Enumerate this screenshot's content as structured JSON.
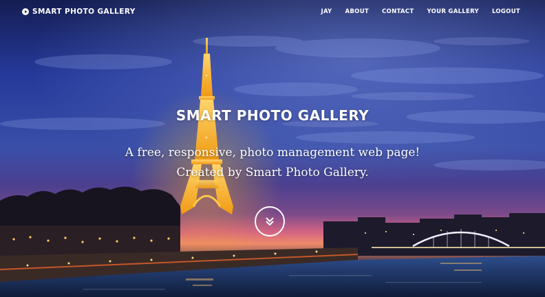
{
  "navbar": {
    "brand_icon": "play-circle-icon",
    "brand_label": "SMART PHOTO GALLERY",
    "links": [
      {
        "label": "JAY"
      },
      {
        "label": "ABOUT"
      },
      {
        "label": "CONTACT"
      },
      {
        "label": "YOUR GALLERY"
      },
      {
        "label": "LOGOUT"
      }
    ]
  },
  "hero": {
    "title": "SMART PHOTO GALLERY",
    "subtitle_line1": "A free, responsive, photo management web page!",
    "subtitle_line2": "Created by Smart Photo Gallery.",
    "scroll_icon": "double-chevron-down-icon",
    "background": "eiffel-tower-night-photo"
  },
  "colors": {
    "text": "#ffffff",
    "sky_top": "#1b2a6b",
    "sky_mid": "#3d56b0",
    "sunset": "#e0607a",
    "tower_lights": "#ffb21e",
    "river": "#1c3b6e"
  }
}
